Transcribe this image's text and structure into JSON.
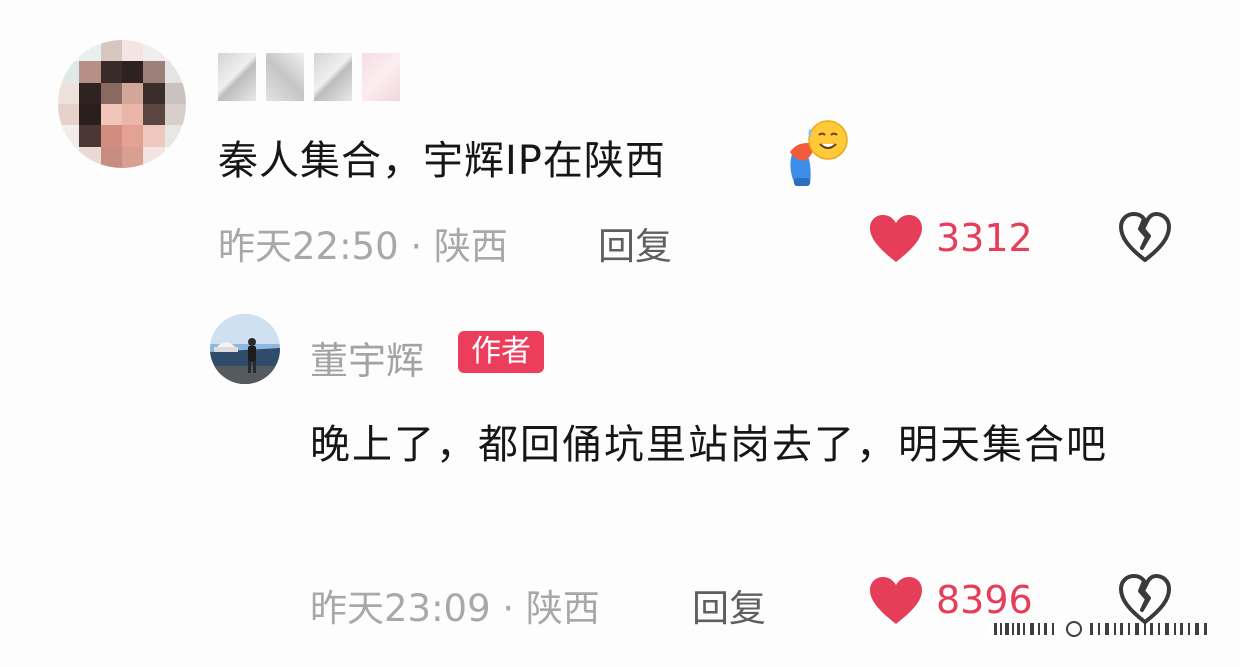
{
  "comment": {
    "avatar": "blurred-avatar",
    "username": "",
    "text": "秦人集合，宇辉IP在陕西",
    "sticker": "bowing-sweat-emoji",
    "meta": "昨天22:50 · 陕西",
    "reply_label": "回复",
    "likes": "3312"
  },
  "reply": {
    "author": "董宇辉",
    "author_badge": "作者",
    "text": "晚上了，都回俑坑里站岗去了，明天集合吧",
    "meta": "昨天23:09 · 陕西",
    "reply_label": "回复",
    "likes": "8396"
  },
  "colors": {
    "like": "#e63d58",
    "badge": "#ed3d5d",
    "meta": "#a8a8a8"
  },
  "icons": [
    "heart-icon",
    "broken-heart-icon"
  ]
}
